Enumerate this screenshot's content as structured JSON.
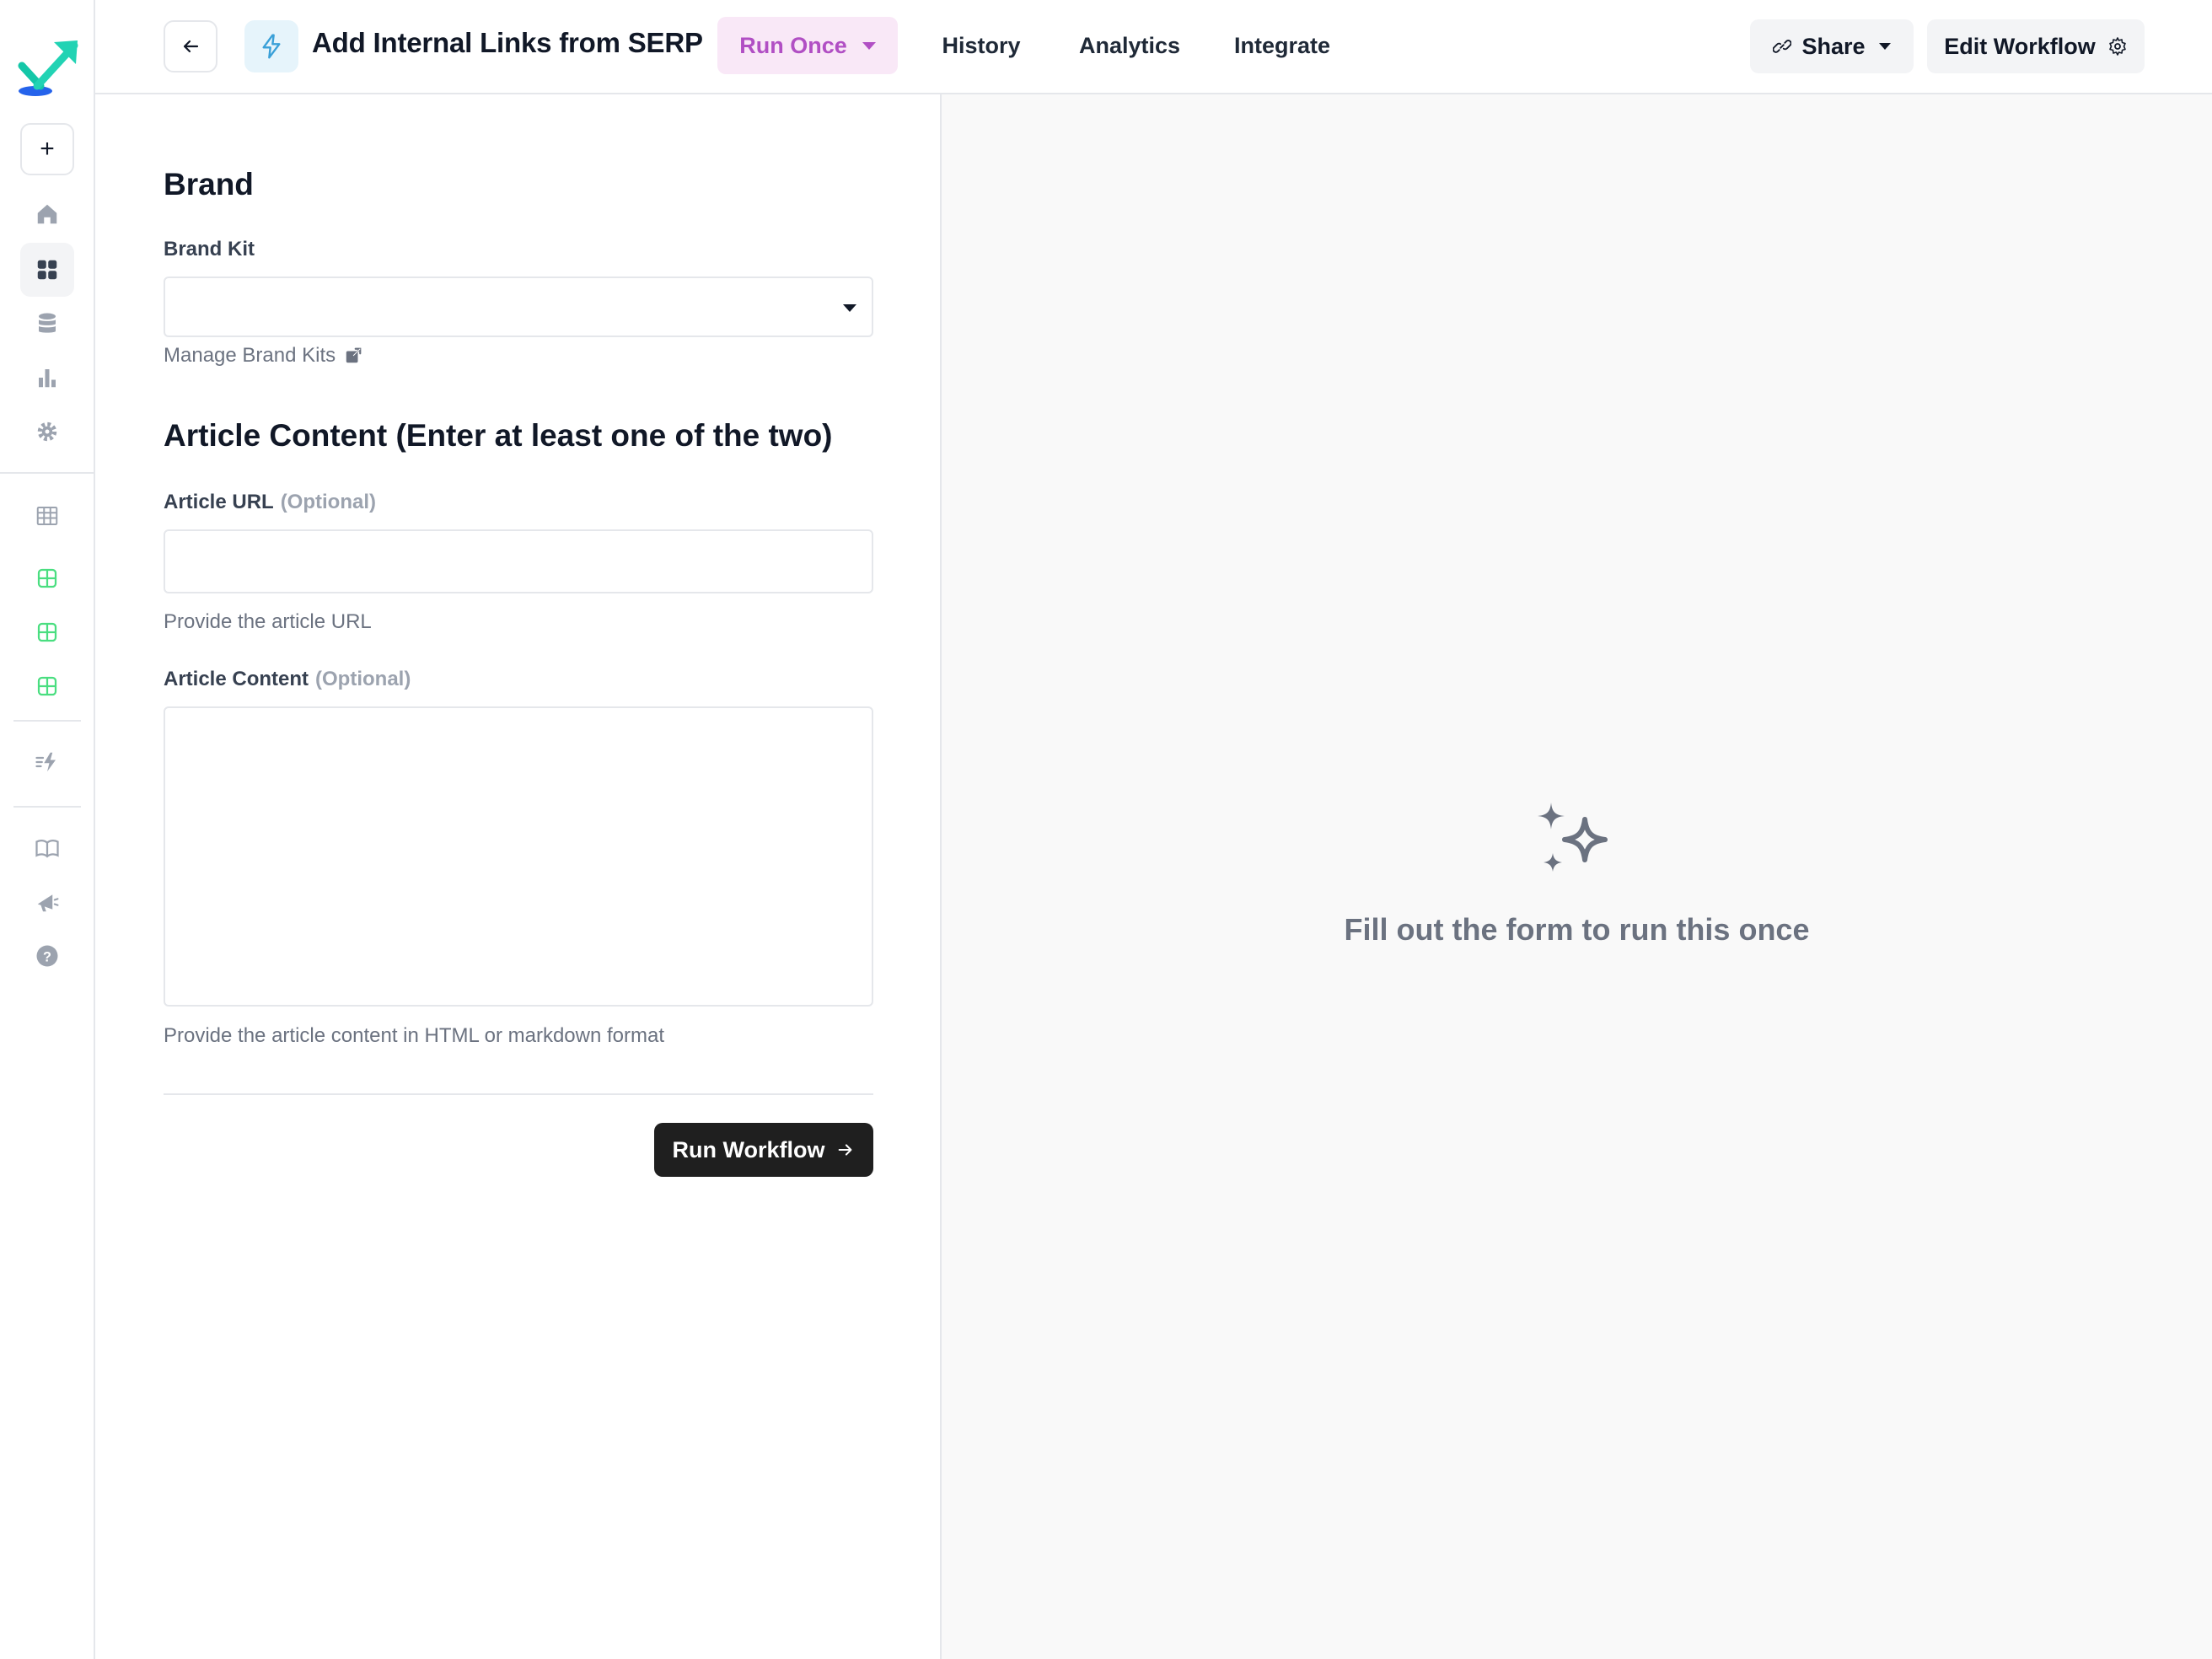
{
  "header": {
    "workflow_title": "Add Internal Links from SERP",
    "tabs": [
      {
        "label": "Run Once",
        "active": true
      },
      {
        "label": "History",
        "active": false
      },
      {
        "label": "Analytics",
        "active": false
      },
      {
        "label": "Integrate",
        "active": false
      }
    ],
    "share_label": "Share",
    "edit_label": "Edit Workflow"
  },
  "sidebar": {
    "new_label": "+",
    "icons": [
      "home-icon",
      "dashboard-icon",
      "database-icon",
      "analytics-icon",
      "settings-icon",
      "table-icon",
      "grid-table-icon",
      "grid-table-icon",
      "grid-table-icon",
      "workflow-bolt-icon",
      "book-icon",
      "megaphone-icon",
      "help-icon"
    ]
  },
  "form": {
    "brand_section": "Brand",
    "brand_kit_label": "Brand Kit",
    "brand_kit_value": "",
    "manage_brand_kits": "Manage Brand Kits",
    "article_section": "Article Content (Enter at least one of the two)",
    "article_url_label": "Article URL",
    "article_url_optional": "(Optional)",
    "article_url_value": "",
    "article_url_help": "Provide the article URL",
    "article_content_label": "Article Content",
    "article_content_optional": "(Optional)",
    "article_content_value": "",
    "article_content_help": "Provide the article content in HTML or markdown format",
    "run_label": "Run Workflow"
  },
  "output": {
    "empty_message": "Fill out the form to run this once"
  },
  "colors": {
    "accent": "#b14fc4",
    "accent_bg": "#f9e8f7",
    "primary_button": "#1f1f1f",
    "logo_teal": "#14c7a8",
    "logo_blue": "#2563eb",
    "table_green": "#4ade80"
  }
}
